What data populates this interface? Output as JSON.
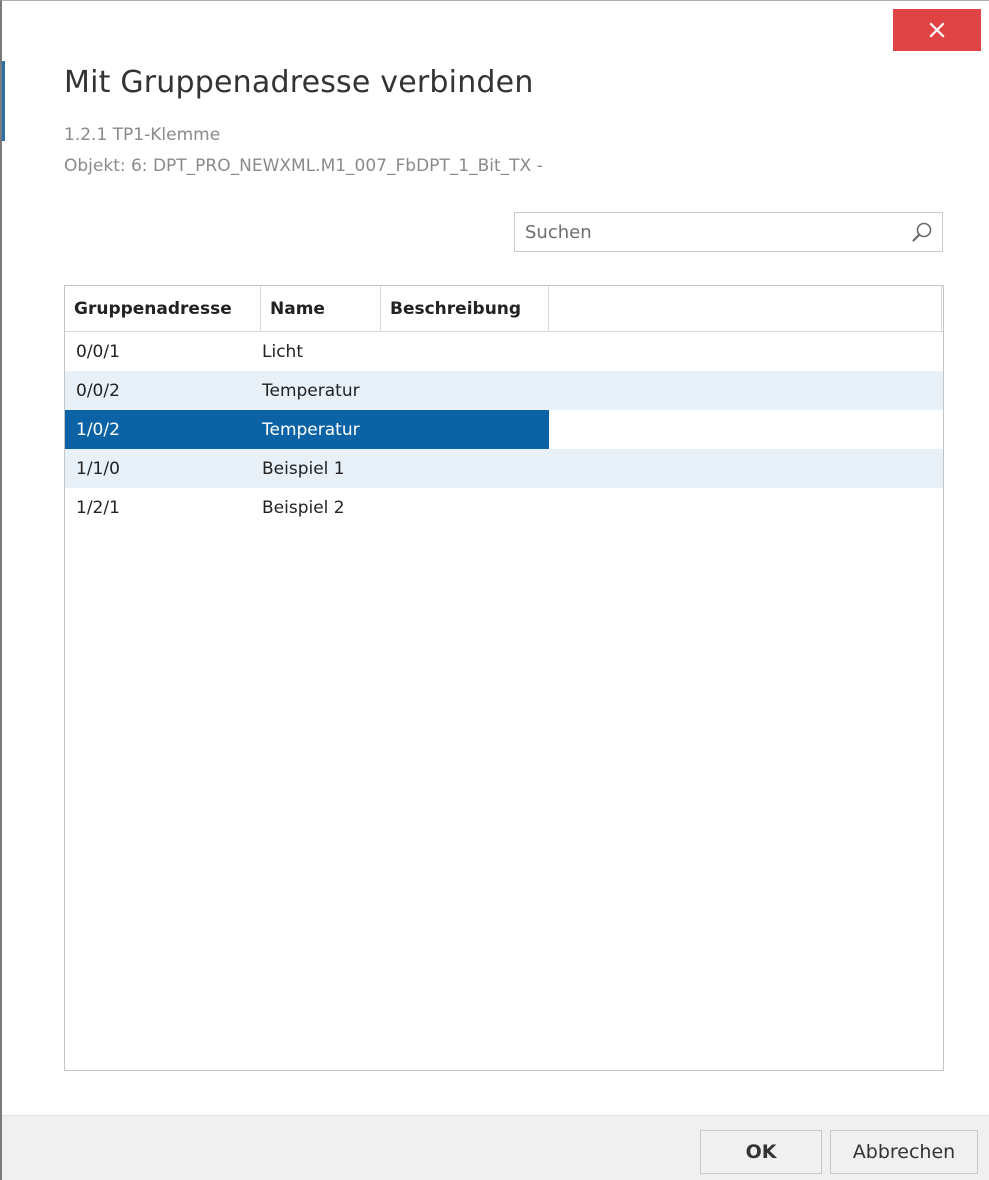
{
  "dialog": {
    "title": "Mit Gruppenadresse verbinden",
    "device": "1.2.1 TP1-Klemme",
    "object": "Objekt: 6: DPT_PRO_NEWXML.M1_007_FbDPT_1_Bit_TX -",
    "close_icon": "close-icon",
    "accent_color": "#e04343",
    "selection_color": "#0b63a5"
  },
  "search": {
    "placeholder": "Suchen",
    "value": "",
    "icon": "search-icon"
  },
  "table": {
    "columns": [
      "Gruppenadresse",
      "Name",
      "Beschreibung",
      ""
    ],
    "rows": [
      {
        "address": "0/0/1",
        "name": "Licht",
        "description": ""
      },
      {
        "address": "0/0/2",
        "name": "Temperatur",
        "description": ""
      },
      {
        "address": "1/0/2",
        "name": "Temperatur",
        "description": "",
        "selected": true
      },
      {
        "address": "1/1/0",
        "name": "Beispiel 1",
        "description": ""
      },
      {
        "address": "1/2/1",
        "name": "Beispiel 2",
        "description": ""
      }
    ]
  },
  "footer": {
    "ok_label": "OK",
    "cancel_label": "Abbrechen"
  }
}
